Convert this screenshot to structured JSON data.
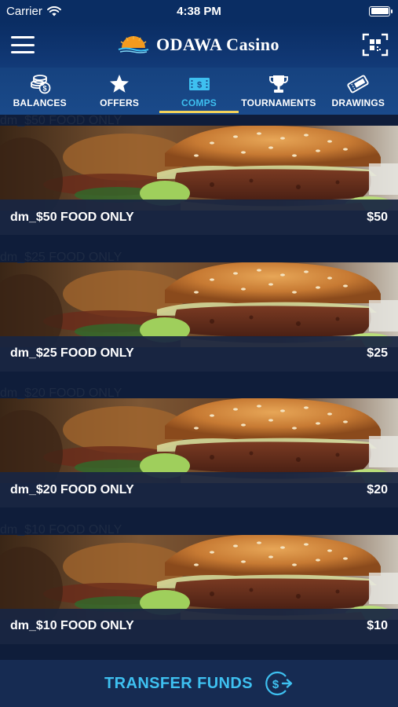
{
  "status": {
    "carrier": "Carrier",
    "time": "4:38 PM"
  },
  "header": {
    "logo_text": "ODAWA Casino"
  },
  "tabs": [
    {
      "label": "BALANCES",
      "icon": "coins-icon",
      "active": false
    },
    {
      "label": "OFFERS",
      "icon": "star-icon",
      "active": false
    },
    {
      "label": "COMPS",
      "icon": "ticket-dollar-icon",
      "active": true
    },
    {
      "label": "TOURNAMENTS",
      "icon": "trophy-icon",
      "active": false
    },
    {
      "label": "DRAWINGS",
      "icon": "raffle-ticket-icon",
      "active": false
    }
  ],
  "comps": [
    {
      "alt": "dm_$50 FOOD ONLY",
      "title": "dm_$50 FOOD ONLY",
      "amount": "$50"
    },
    {
      "alt": "dm_$25 FOOD ONLY",
      "title": "dm_$25 FOOD ONLY",
      "amount": "$25"
    },
    {
      "alt": "dm_$20 FOOD ONLY",
      "title": "dm_$20 FOOD ONLY",
      "amount": "$20"
    },
    {
      "alt": "dm_$10 FOOD ONLY",
      "title": "dm_$10 FOOD ONLY",
      "amount": "$10"
    }
  ],
  "footer": {
    "label": "TRANSFER FUNDS"
  },
  "colors": {
    "accent": "#3ec0f0",
    "tab_underline": "#f3d35a",
    "header": "#0a2d63"
  }
}
